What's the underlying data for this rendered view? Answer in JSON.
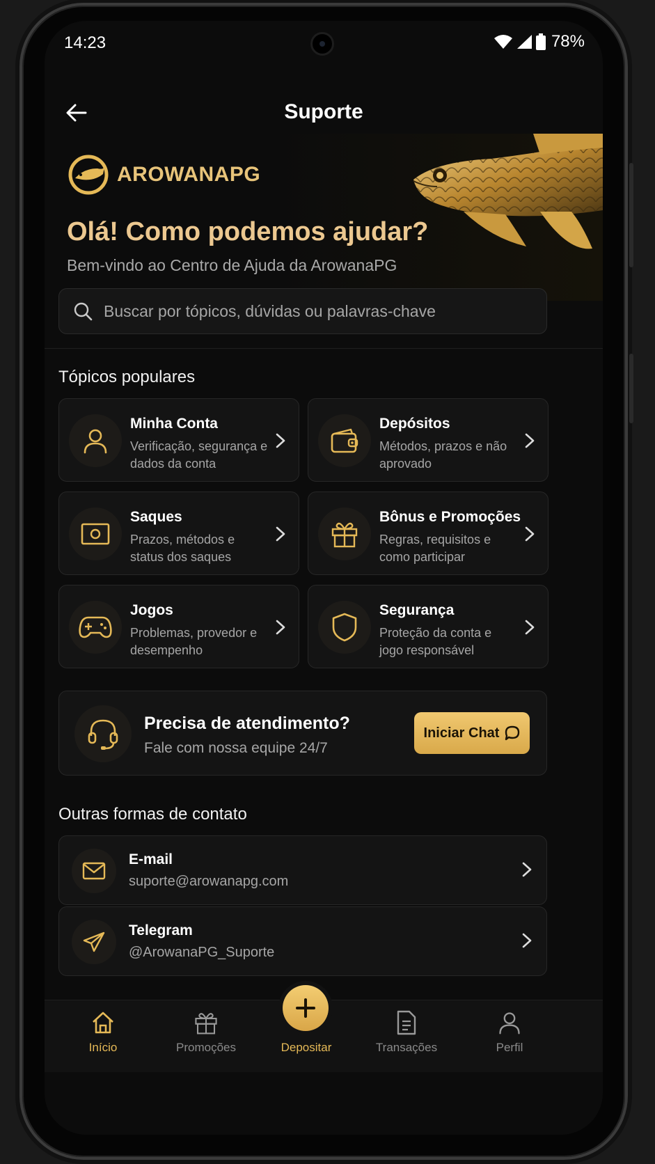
{
  "status_bar": {
    "time": "14:23",
    "battery": "78%"
  },
  "header": {
    "title": "Suporte"
  },
  "hero": {
    "brand": "AROWANAPG",
    "title": "Olá! Como podemos ajudar?",
    "subtitle": "Bem-vindo ao Centro de Ajuda da ArowanaPG"
  },
  "search": {
    "placeholder": "Buscar por tópicos, dúvidas ou palavras-chave"
  },
  "popular": {
    "title": "Tópicos populares",
    "topics": [
      {
        "title": "Minha Conta",
        "desc": "Verificação, segurança e dados da conta",
        "icon": "user-icon"
      },
      {
        "title": "Depósitos",
        "desc": "Métodos, prazos e não aprovado",
        "icon": "wallet-icon"
      },
      {
        "title": "Saques",
        "desc": "Prazos, métodos e status dos saques",
        "icon": "cash-icon"
      },
      {
        "title": "Bônus e Promoções",
        "desc": "Regras, requisitos e como participar",
        "icon": "gift-icon"
      },
      {
        "title": "Jogos",
        "desc": "Problemas, provedor e desempenho",
        "icon": "gamepad-icon"
      },
      {
        "title": "Segurança",
        "desc": "Proteção da conta e jogo responsável",
        "icon": "shield-icon"
      }
    ]
  },
  "help": {
    "title": "Precisa de atendimento?",
    "subtitle": "Fale com nossa equipe 24/7",
    "button": "Iniciar Chat"
  },
  "contacts": {
    "title": "Outras formas de contato",
    "items": [
      {
        "title": "E-mail",
        "value": "suporte@arowanapg.com",
        "icon": "mail-icon"
      },
      {
        "title": "Telegram",
        "value": "@ArowanaPG_Suporte",
        "icon": "telegram-icon"
      }
    ]
  },
  "nav": {
    "items": [
      {
        "label": "Início",
        "icon": "home-icon",
        "active": true
      },
      {
        "label": "Promoções",
        "icon": "gift-icon",
        "active": false
      },
      {
        "label": "Depositar",
        "icon": "plus-icon",
        "active": true
      },
      {
        "label": "Transações",
        "icon": "document-icon",
        "active": false
      },
      {
        "label": "Perfil",
        "icon": "user-icon",
        "active": false
      }
    ]
  },
  "colors": {
    "accent": "#E5B957",
    "background": "#0C0C0C",
    "card": "#141414"
  }
}
